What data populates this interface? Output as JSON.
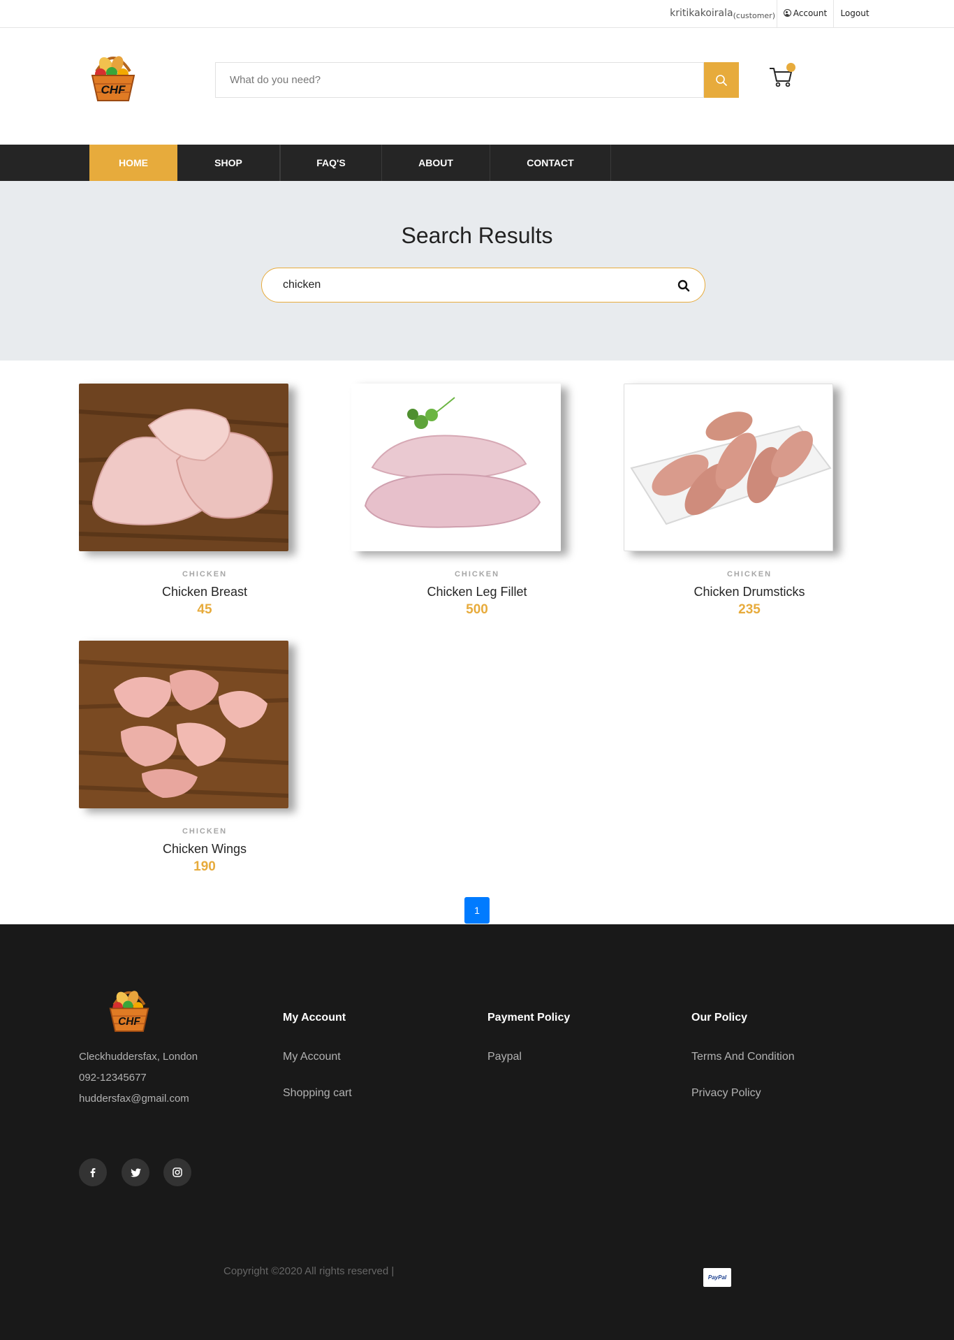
{
  "topbar": {
    "username": "kritikakoirala",
    "role": "(customer)",
    "account_label": "Account",
    "logout_label": "Logout"
  },
  "header": {
    "logo_text": "CHF",
    "search_placeholder": "What do you need?",
    "search_icon": "search-icon",
    "cart_icon": "cart-icon"
  },
  "nav": {
    "items": [
      {
        "label": "HOME",
        "active": true
      },
      {
        "label": "SHOP",
        "active": false
      },
      {
        "label": "FAQ'S",
        "active": false
      },
      {
        "label": "ABOUT",
        "active": false
      },
      {
        "label": "CONTACT",
        "active": false
      }
    ]
  },
  "hero": {
    "title": "Search Results",
    "search_value": "chicken"
  },
  "products": [
    {
      "category": "CHICKEN",
      "name": "Chicken Breast",
      "price": "45"
    },
    {
      "category": "CHICKEN",
      "name": "Chicken Leg Fillet",
      "price": "500"
    },
    {
      "category": "CHICKEN",
      "name": "Chicken Drumsticks",
      "price": "235"
    },
    {
      "category": "CHICKEN",
      "name": "Chicken Wings",
      "price": "190"
    }
  ],
  "pagination": {
    "current": "1"
  },
  "footer": {
    "logo_text": "CHF",
    "address": "Cleckhuddersfax, London",
    "phone": "092-12345677",
    "email": "huddersfax@gmail.com",
    "columns": [
      {
        "heading": "My Account",
        "links": [
          "My Account",
          "Shopping cart"
        ]
      },
      {
        "heading": "Payment Policy",
        "links": [
          "Paypal"
        ]
      },
      {
        "heading": "Our Policy",
        "links": [
          "Terms And Condition",
          "Privacy Policy"
        ]
      }
    ],
    "social": [
      "facebook-icon",
      "twitter-icon",
      "instagram-icon"
    ],
    "copyright": "Copyright ©2020 All rights reserved |",
    "payment_badge": "PayPal"
  },
  "colors": {
    "accent": "#e7ab3c",
    "nav_bg": "#252525",
    "hero_bg": "#e8ebee",
    "footer_bg": "#191919",
    "pagination": "#007bff"
  }
}
